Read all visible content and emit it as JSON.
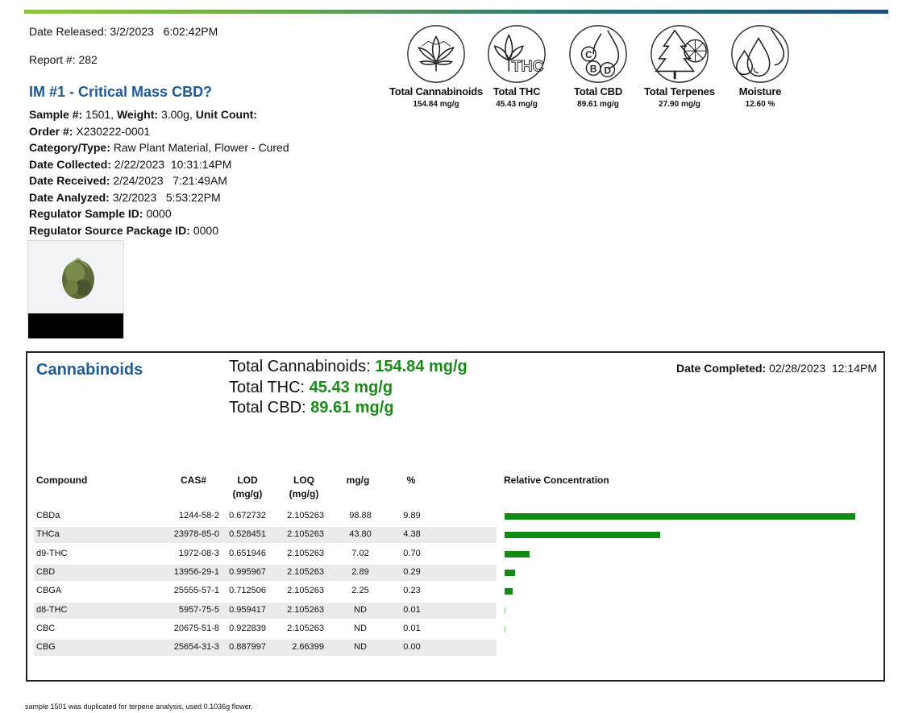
{
  "header": {
    "date_released_label": "Date Released:",
    "date_released": "3/2/2023   6:02:42PM",
    "report_label": "Report #:",
    "report_number": "282"
  },
  "sample_title": "IM #1 - Critical Mass CBD?",
  "sample_info": {
    "sample_label": "Sample #:",
    "sample_number": "1501,",
    "weight_label": "Weight:",
    "weight": "3.00g,",
    "unit_count_label": "Unit Count:",
    "order_label": "Order #:",
    "order": "X230222-0001",
    "category_label": "Category/Type:",
    "category": "Raw Plant Material, Flower - Cured",
    "collected_label": "Date Collected:",
    "collected": "2/22/2023  10:31:14PM",
    "received_label": "Date Received:",
    "received": "2/24/2023   7:21:49AM",
    "analyzed_label": "Date Analyzed:",
    "analyzed": "3/2/2023   5:53:22PM",
    "regulator_sample_label": "Regulator Sample ID:",
    "regulator_sample": "0000",
    "regulator_package_label": "Regulator Source Package ID:",
    "regulator_package": "0000"
  },
  "summary": [
    {
      "label": "Total Cannabinoids",
      "value": "154.84 mg/g",
      "icon": "cannabis-leaf-icon"
    },
    {
      "label": "Total THC",
      "value": "45.43 mg/g",
      "icon": "thc-leaf-icon"
    },
    {
      "label": "Total CBD",
      "value": "89.61 mg/g",
      "icon": "cbd-drop-icon"
    },
    {
      "label": "Total Terpenes",
      "value": "27.90 mg/g",
      "icon": "tree-lemon-icon"
    },
    {
      "label": "Moisture",
      "value": "12.60 %",
      "icon": "water-drops-icon"
    }
  ],
  "cannabinoids": {
    "title": "Cannabinoids",
    "total_cannabinoids_label": "Total Cannabinoids:",
    "total_cannabinoids": "154.84 mg/g",
    "total_thc_label": "Total THC:",
    "total_thc": "45.43 mg/g",
    "total_cbd_label": "Total CBD:",
    "total_cbd": "89.61 mg/g",
    "date_completed_label": "Date Completed:",
    "date_completed": "02/28/2023  12:14PM",
    "headers": {
      "compound": "Compound",
      "cas": "CAS#",
      "lod": "LOD",
      "lod_unit": "(mg/g)",
      "loq": "LOQ",
      "loq_unit": "(mg/g)",
      "mgg": "mg/g",
      "pct": "%",
      "relative": "Relative Concentration"
    },
    "rows": [
      {
        "compound": "CBDa",
        "cas": "1244-58-2",
        "lod": "0.672732",
        "loq": "2.105263",
        "mgg": "98.88",
        "pct": "9.89",
        "rel": 98.88
      },
      {
        "compound": "THCa",
        "cas": "23978-85-0",
        "lod": "0.528451",
        "loq": "2.105263",
        "mgg": "43.80",
        "pct": "4.38",
        "rel": 43.8
      },
      {
        "compound": "d9-THC",
        "cas": "1972-08-3",
        "lod": "0.651946",
        "loq": "2.105263",
        "mgg": "7.02",
        "pct": "0.70",
        "rel": 7.02
      },
      {
        "compound": "CBD",
        "cas": "13956-29-1",
        "lod": "0.995967",
        "loq": "2.105263",
        "mgg": "2.89",
        "pct": "0.29",
        "rel": 2.89
      },
      {
        "compound": "CBGA",
        "cas": "25555-57-1",
        "lod": "0.712506",
        "loq": "2.105263",
        "mgg": "2.25",
        "pct": "0.23",
        "rel": 2.25
      },
      {
        "compound": "d8-THC",
        "cas": "5957-75-5",
        "lod": "0.959417",
        "loq": "2.105263",
        "mgg": "ND",
        "pct": "0.01",
        "rel": 0.1
      },
      {
        "compound": "CBC",
        "cas": "20675-51-8",
        "lod": "0.922839",
        "loq": "2.105263",
        "mgg": "ND",
        "pct": "0.01",
        "rel": 0.1
      },
      {
        "compound": "CBG",
        "cas": "25654-31-3",
        "lod": "0.887997",
        "loq": "2.66399",
        "mgg": "ND",
        "pct": "0.00",
        "rel": 0
      }
    ]
  },
  "footnote": "sample 1501 was duplicated for terpene analysis, used 0.1036g flower.",
  "colors": {
    "accent_blue": "#1e5b96",
    "accent_green": "#1a8a1a",
    "bar_green": "#138a13"
  }
}
